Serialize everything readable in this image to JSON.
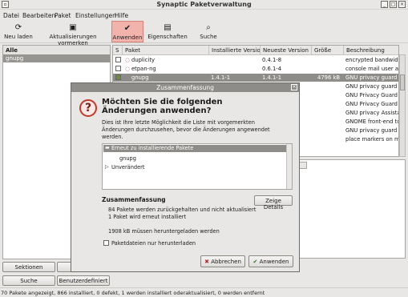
{
  "window": {
    "title": "Synaptic Paketverwaltung"
  },
  "menu": [
    "Datei",
    "Bearbeiten",
    "Paket",
    "Einstellungen",
    "Hilfe"
  ],
  "toolbar": {
    "reload": "Neu laden",
    "mark_updates": "Aktualisierungen vormerken",
    "apply": "Anwenden",
    "properties": "Eigenschaften",
    "search": "Suche"
  },
  "sidebar": {
    "header": "Alle",
    "selected": "gnupg"
  },
  "table": {
    "columns": [
      "S",
      "Paket",
      "Installierte Version",
      "Neueste Version",
      "Größe",
      "Beschreibung"
    ],
    "rows": [
      {
        "name": "duplicity",
        "installed": "",
        "latest": "0.4.1-8",
        "size": "",
        "desc": "encrypted bandwidth"
      },
      {
        "name": "etpan-ng",
        "installed": "",
        "latest": "0.6.1-4",
        "size": "",
        "desc": "console mail user ag"
      },
      {
        "name": "gnupg",
        "installed": "1.4.1-1",
        "latest": "1.4.1-1",
        "size": "4796 kB",
        "desc": "GNU privacy guard -"
      },
      {
        "name": "",
        "installed": "",
        "latest": "",
        "size": "",
        "desc": "GNU privacy guard -"
      },
      {
        "name": "",
        "installed": "",
        "latest": "",
        "size": "",
        "desc": "GNU Privacy Guard"
      },
      {
        "name": "",
        "installed": "",
        "latest": "",
        "size": "",
        "desc": "GNU Privacy Guard o"
      },
      {
        "name": "",
        "installed": "",
        "latest": "",
        "size": "",
        "desc": "GNU privacy Assista"
      },
      {
        "name": "",
        "installed": "",
        "latest": "",
        "size": "",
        "desc": "GNOME front-end to"
      },
      {
        "name": "",
        "installed": "",
        "latest": "",
        "size": "",
        "desc": "GNU privacy guard -"
      },
      {
        "name": "",
        "installed": "",
        "latest": "",
        "size": "",
        "desc": "place markers on ma"
      }
    ]
  },
  "left_buttons": {
    "sections": "Sektionen",
    "search": "Suche",
    "custom": "Benutzerdefiniert"
  },
  "status": "70 Pakete angezeigt, 866 installiert, 0 defekt, 1 werden installiert oderaktualisiert, 0 werden entfernt",
  "dialog": {
    "title": "Zusammenfassung",
    "heading": "Möchten Sie die folgenden Änderungen anwenden?",
    "text": "Dies ist Ihre letzte Möglichkeit die Liste mit vorgemerkten Änderungen durchzusehen, bevor die Änderungen angewendet werden.",
    "tree": {
      "group1": "Erneut zu installierende Pakete",
      "item1": "gnupg",
      "group2": "Unverändert"
    },
    "summary_heading": "Zusammenfassung",
    "details_button": "Zeige Details",
    "summary_lines": [
      "84 Pakete werden zurückgehalten und nicht aktualisiert",
      "1 Paket wird erneut installiert",
      "1908 kB müssen heruntergeladen werden"
    ],
    "download_only": "Paketdateien nur herunterladen",
    "cancel": "Abbrechen",
    "apply": "Anwenden"
  }
}
